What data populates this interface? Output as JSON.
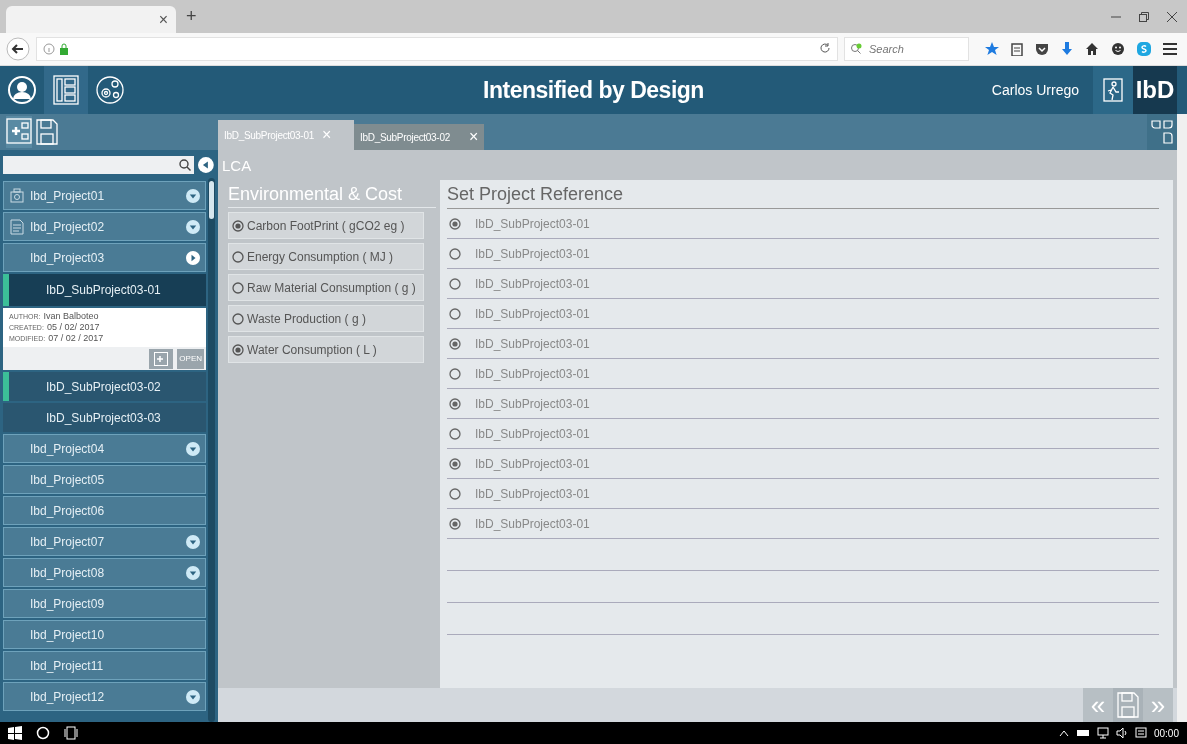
{
  "browser": {
    "tab_close": "×",
    "new_tab": "+",
    "search_placeholder": "Search"
  },
  "header": {
    "title": "Intensified by Design",
    "user": "Carlos Urrego",
    "logo": "IbD"
  },
  "doc_tabs": [
    {
      "label": "IbD_SubProject03-01",
      "close": "×",
      "selected": true
    },
    {
      "label": "IbD_SubProject03-02",
      "close": "×",
      "selected": false
    }
  ],
  "section": "LCA",
  "sidebar": {
    "items": [
      {
        "label": "Ibd_Project01",
        "kind": "equipment",
        "collapsible": true
      },
      {
        "label": "Ibd_Project02",
        "kind": "document",
        "collapsible": true
      },
      {
        "label": "Ibd_Project03",
        "kind": "project",
        "collapsible": true,
        "expanded": true,
        "children": [
          {
            "label": "IbD_SubProject03-01",
            "selected": true,
            "details": {
              "author_label": "AUTHOR:",
              "author": "Ivan Balboteo",
              "created_label": "CREATED:",
              "created": "05 / 02/ 2017",
              "modified_label": "MODIFIED:",
              "modified": "07 / 02 / 2017",
              "open": "OPEN"
            }
          },
          {
            "label": "IbD_SubProject03-02",
            "selected": false,
            "marked": true
          },
          {
            "label": "IbD_SubProject03-03",
            "selected": false,
            "marked": false
          }
        ]
      },
      {
        "label": "Ibd_Project04",
        "kind": "project",
        "collapsible": true
      },
      {
        "label": "Ibd_Project05",
        "kind": "project",
        "collapsible": false
      },
      {
        "label": "Ibd_Project06",
        "kind": "project",
        "collapsible": false
      },
      {
        "label": "Ibd_Project07",
        "kind": "project",
        "collapsible": true
      },
      {
        "label": "Ibd_Project08",
        "kind": "project",
        "collapsible": true
      },
      {
        "label": "Ibd_Project09",
        "kind": "project",
        "collapsible": false
      },
      {
        "label": "Ibd_Project10",
        "kind": "project",
        "collapsible": false
      },
      {
        "label": "Ibd_Project11",
        "kind": "project",
        "collapsible": false
      },
      {
        "label": "Ibd_Project12",
        "kind": "project",
        "collapsible": true
      }
    ]
  },
  "categories": {
    "title": "Environmental & Cost",
    "options": [
      {
        "label": "Carbon FootPrint ( gCO2 eg )",
        "selected": true
      },
      {
        "label": "Energy Consumption ( MJ )",
        "selected": false
      },
      {
        "label": "Raw Material Consumption ( g )",
        "selected": false
      },
      {
        "label": "Waste Production ( g )",
        "selected": false
      },
      {
        "label": "Water Consumption ( L )",
        "selected": true
      }
    ]
  },
  "reference": {
    "title": "Set Project Reference",
    "rows": [
      {
        "label": "IbD_SubProject03-01",
        "selected": true
      },
      {
        "label": "IbD_SubProject03-01",
        "selected": false
      },
      {
        "label": "IbD_SubProject03-01",
        "selected": false
      },
      {
        "label": "IbD_SubProject03-01",
        "selected": false
      },
      {
        "label": "IbD_SubProject03-01",
        "selected": true
      },
      {
        "label": "IbD_SubProject03-01",
        "selected": false
      },
      {
        "label": "IbD_SubProject03-01",
        "selected": true
      },
      {
        "label": "IbD_SubProject03-01",
        "selected": false
      },
      {
        "label": "IbD_SubProject03-01",
        "selected": true
      },
      {
        "label": "IbD_SubProject03-01",
        "selected": false
      },
      {
        "label": "IbD_SubProject03-01",
        "selected": true
      }
    ]
  },
  "nav": {
    "prev": "«",
    "next": "»"
  },
  "taskbar": {
    "clock": "00:00"
  }
}
